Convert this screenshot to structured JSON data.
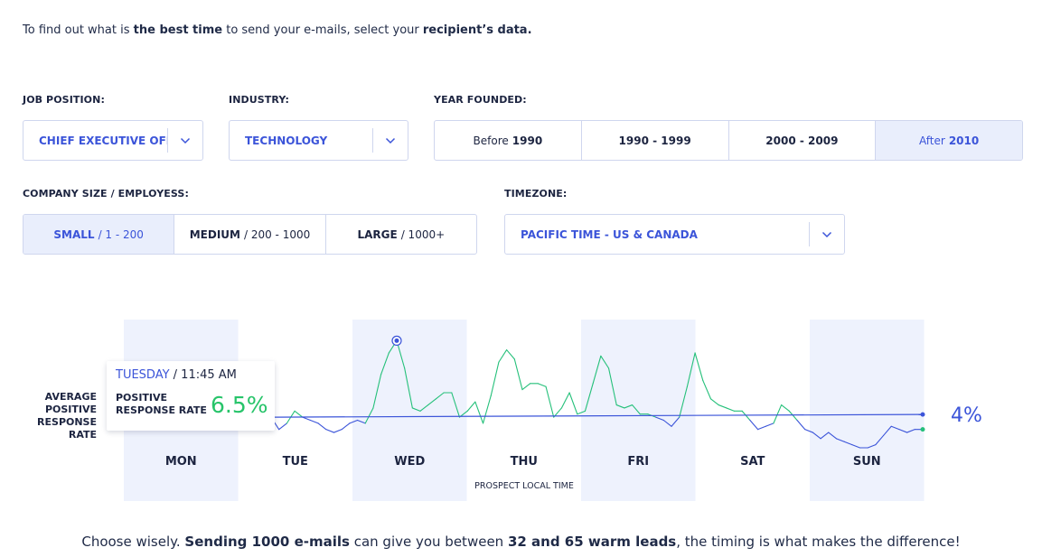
{
  "intro": {
    "part1": "To find out what is ",
    "bold1": "the best time",
    "part2": " to send your e-mails, select your ",
    "bold2": "recipient’s data."
  },
  "job_position": {
    "label": "JOB POSITION:",
    "value": "CHIEF EXECUTIVE OFFIC"
  },
  "industry": {
    "label": "INDUSTRY:",
    "value": "TECHNOLOGY"
  },
  "year_founded": {
    "label": "YEAR FOUNDED:",
    "options": [
      {
        "prefix": "Before",
        "value": "1990",
        "active": false
      },
      {
        "prefix": "",
        "value": "1990 - 1999",
        "active": false
      },
      {
        "prefix": "",
        "value": "2000 - 2009",
        "active": false
      },
      {
        "prefix": "After",
        "value": "2010",
        "active": true
      }
    ]
  },
  "company_size": {
    "label": "COMPANY SIZE / EMPLOYESS:",
    "options": [
      {
        "name": "SMALL",
        "range": "/ 1 - 200",
        "active": true
      },
      {
        "name": "MEDIUM",
        "range": "/ 200 - 1000",
        "active": false
      },
      {
        "name": "LARGE",
        "range": "/ 1000+",
        "active": false
      }
    ]
  },
  "timezone": {
    "label": "TIMEZONE:",
    "value": "PACIFIC TIME - US & CANADA"
  },
  "tooltip": {
    "day": "TUESDAY",
    "time": " / 11:45 AM",
    "label_line1": "POSITIVE",
    "label_line2": "RESPONSE RATE",
    "value": "6.5%"
  },
  "y_label": [
    "AVERAGE",
    "POSITIVE",
    "RESPONSE",
    "RATE"
  ],
  "average_label": "4%",
  "chart_data": {
    "type": "line",
    "x_label": "PROSPECT LOCAL TIME",
    "categories": [
      "MON",
      "TUE",
      "WED",
      "THU",
      "FRI",
      "SAT",
      "SUN"
    ],
    "series": [
      {
        "values": [
          4.0,
          3.6,
          3.8,
          4.2,
          4.0,
          3.9,
          3.8,
          3.6,
          3.5,
          3.6,
          3.8,
          3.9,
          3.8,
          4.3,
          5.4,
          6.1,
          6.5,
          5.6,
          4.3,
          4.2,
          4.4,
          4.6,
          4.8,
          4.8,
          4.0,
          4.2,
          4.5,
          3.8,
          4.7,
          5.8,
          6.2,
          5.9,
          4.9,
          5.1,
          5.1,
          5.0,
          4.0,
          4.3,
          4.8,
          4.1,
          4.2,
          5.1,
          6.0,
          5.6,
          4.4,
          4.3,
          4.4,
          4.1,
          4.1,
          4.0,
          3.9,
          3.7,
          4.0,
          5.0,
          6.1,
          5.2,
          4.6,
          4.4,
          4.3,
          4.2,
          4.2,
          3.9,
          3.6,
          3.7,
          3.8,
          4.4,
          4.2,
          3.9,
          3.6,
          3.5,
          3.3,
          3.5,
          3.3,
          3.2,
          3.1,
          3.0,
          3.0,
          3.1,
          3.4,
          3.7,
          3.6,
          3.5,
          3.6,
          3.6
        ]
      }
    ],
    "average": 4.0,
    "highlight": {
      "day": "TUESDAY",
      "time": "11:45 AM",
      "value": 6.5
    },
    "shaded_days": [
      "MON",
      "WED",
      "FRI",
      "SUN"
    ],
    "colors": {
      "above": "#25c07a",
      "below": "#3b54d9",
      "shade": "#eef2fd",
      "average": "#3b54d9"
    }
  },
  "footer": {
    "part1": "Choose wisely. ",
    "bold1": "Sending 1000 e-mails",
    "part2": " can give you between ",
    "bold2": "32 and 65 warm leads",
    "part3": ", the timing is what makes the difference!"
  }
}
